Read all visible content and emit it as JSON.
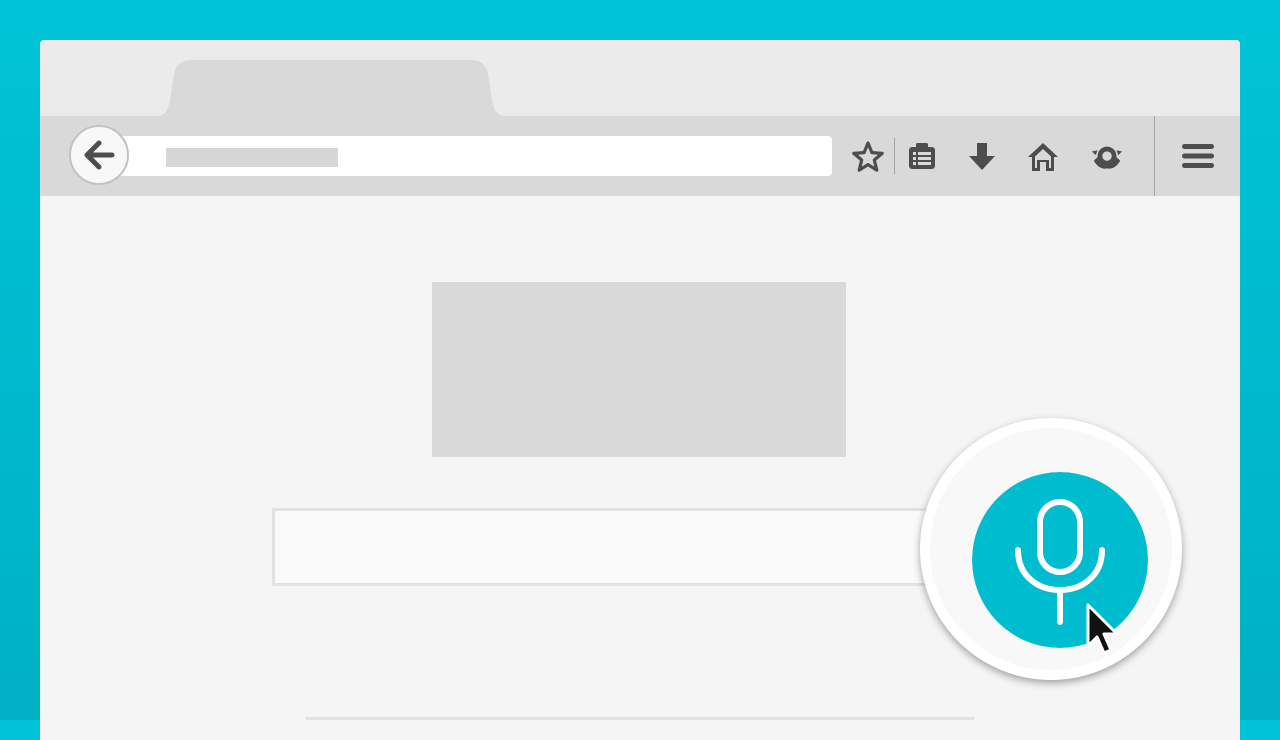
{
  "theme": {
    "background": "#00bcd0",
    "accent": "#00bccf",
    "icon_color": "#4d4d4d",
    "toolbar": "#d9d9d9",
    "tabstrip": "#ebebeb",
    "content": "#f5f5f5"
  },
  "browser": {
    "tab_label": "",
    "url": "",
    "icons": [
      "back-arrow-icon",
      "star-icon",
      "reading-list-icon",
      "download-icon",
      "home-icon",
      "sync-icon",
      "hamburger-menu-icon"
    ]
  },
  "page": {
    "search_value": "",
    "voice_button_icon": "microphone-icon"
  }
}
